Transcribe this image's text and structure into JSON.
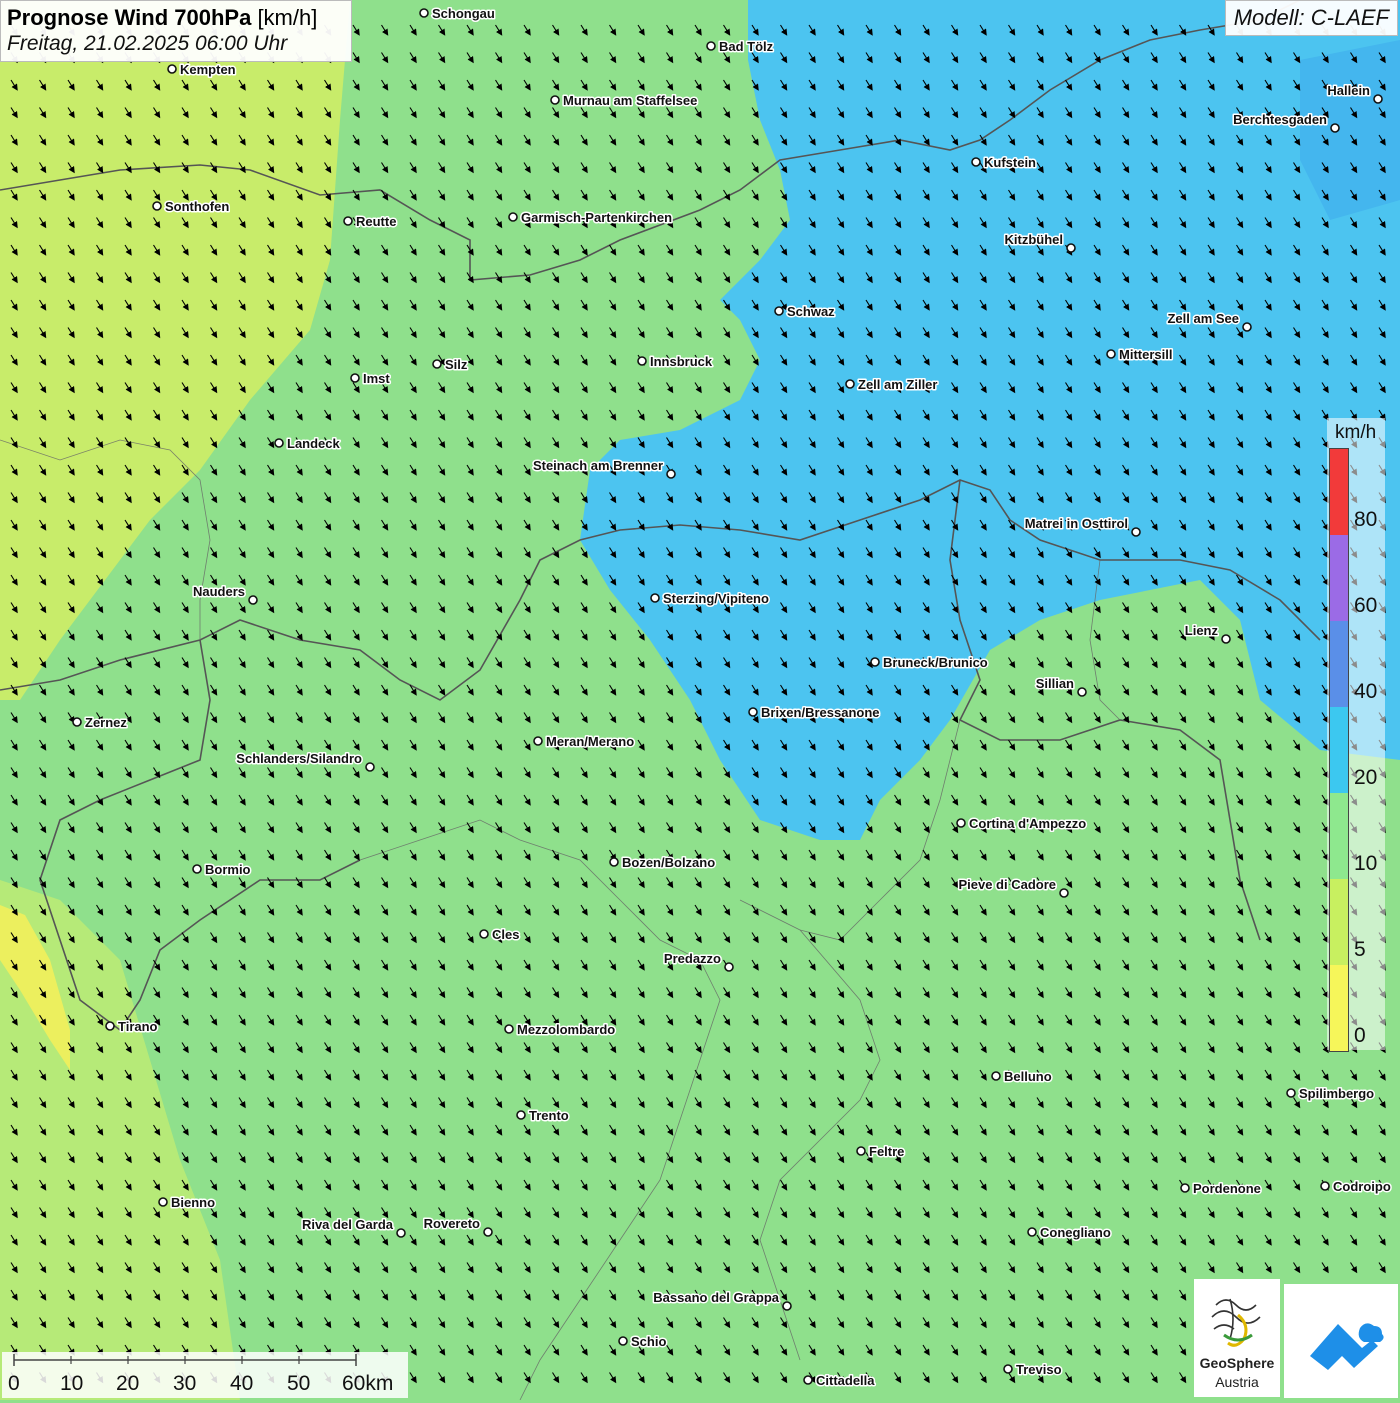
{
  "title": {
    "main": "Prognose Wind 700hPa",
    "unit": "[km/h]",
    "subtitle": "Freitag, 21.02.2025 06:00 Uhr"
  },
  "model_label": "Modell: C-LAEF",
  "legend": {
    "unit": "km/h",
    "ticks": [
      "80",
      "60",
      "40",
      "20",
      "10",
      "5",
      "0"
    ],
    "colors": [
      "#f23a3a",
      "#9b6be6",
      "#5a8fe8",
      "#3cc8f0",
      "#8ee88e",
      "#c8f060",
      "#f6f65a"
    ]
  },
  "scale_bar": {
    "labels": [
      "0",
      "10",
      "20",
      "30",
      "40",
      "50",
      "60km"
    ]
  },
  "logos": {
    "geosphere_line1": "GeoSphere",
    "geosphere_line2": "Austria",
    "app_icon": "mountain-cloud-icon"
  },
  "colors": {
    "wind_under_10": "#8fe08c",
    "wind_5_10": "#c8ec6a",
    "wind_20_40": "#4cc4f0",
    "wind_0_5": "#f0f060",
    "border": "#555555",
    "arrow": "#000000"
  },
  "wind_direction": "south-east",
  "cities": [
    {
      "name": "Schongau"
    },
    {
      "name": "Bad Tölz"
    },
    {
      "name": "Kempten"
    },
    {
      "name": "Murnau am Staffelsee"
    },
    {
      "name": "Hallein"
    },
    {
      "name": "Berchtesgaden"
    },
    {
      "name": "Kufstein"
    },
    {
      "name": "Sonthofen"
    },
    {
      "name": "Reutte"
    },
    {
      "name": "Garmisch-Partenkirchen"
    },
    {
      "name": "Kitzbühel"
    },
    {
      "name": "Schwaz"
    },
    {
      "name": "Zell am See"
    },
    {
      "name": "Mittersill"
    },
    {
      "name": "Silz"
    },
    {
      "name": "Innsbruck"
    },
    {
      "name": "Imst"
    },
    {
      "name": "Zell am Ziller"
    },
    {
      "name": "Landeck"
    },
    {
      "name": "Steinach am Brenner"
    },
    {
      "name": "Matrei in Osttirol"
    },
    {
      "name": "Nauders"
    },
    {
      "name": "Sterzing/Vipiteno"
    },
    {
      "name": "Lienz"
    },
    {
      "name": "Bruneck/Brunico"
    },
    {
      "name": "Sillian"
    },
    {
      "name": "Brixen/Bressanone"
    },
    {
      "name": "Zernez"
    },
    {
      "name": "Meran/Merano"
    },
    {
      "name": "Schlanders/Silandro"
    },
    {
      "name": "Cortina d'Ampezzo"
    },
    {
      "name": "Bozen/Bolzano"
    },
    {
      "name": "Bormio"
    },
    {
      "name": "Pieve di Cadore"
    },
    {
      "name": "Cles"
    },
    {
      "name": "Predazzo"
    },
    {
      "name": "Tirano"
    },
    {
      "name": "Mezzolombardo"
    },
    {
      "name": "Belluno"
    },
    {
      "name": "Spilimbergo"
    },
    {
      "name": "Trento"
    },
    {
      "name": "Feltre"
    },
    {
      "name": "Pordenone"
    },
    {
      "name": "Codroipo"
    },
    {
      "name": "Bienno"
    },
    {
      "name": "Riva del Garda"
    },
    {
      "name": "Rovereto"
    },
    {
      "name": "Conegliano"
    },
    {
      "name": "Bassano del Grappa"
    },
    {
      "name": "Schio"
    },
    {
      "name": "Treviso"
    },
    {
      "name": "Cittadella"
    }
  ]
}
